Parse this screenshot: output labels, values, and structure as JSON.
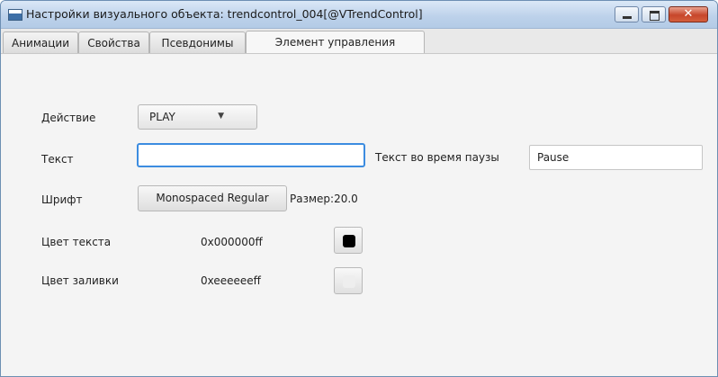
{
  "window": {
    "title": "Настройки визуального объекта: trendcontrol_004[@VTrendControl]",
    "buttons": {
      "minimize": "minimize",
      "maximize": "maximize",
      "close": "✕"
    }
  },
  "tabs": [
    {
      "label": "Анимации",
      "active": false
    },
    {
      "label": "Свойства",
      "active": false
    },
    {
      "label": "Псевдонимы",
      "active": false
    },
    {
      "label": "Элемент управления",
      "active": true
    }
  ],
  "form": {
    "action": {
      "label": "Действие",
      "value": "PLAY"
    },
    "text": {
      "label": "Текст",
      "value": ""
    },
    "pause_text": {
      "label": "Текст во время паузы",
      "value": "Pause"
    },
    "font": {
      "label": "Шрифт",
      "value": "Monospaced Regular",
      "size": "Размер:20.0"
    },
    "text_color": {
      "label": "Цвет текста",
      "value": "0x000000ff",
      "swatch": "#000000"
    },
    "fill_color": {
      "label": "Цвет заливки",
      "value": "0xeeeeeeff",
      "swatch": "#eeeeee"
    }
  }
}
